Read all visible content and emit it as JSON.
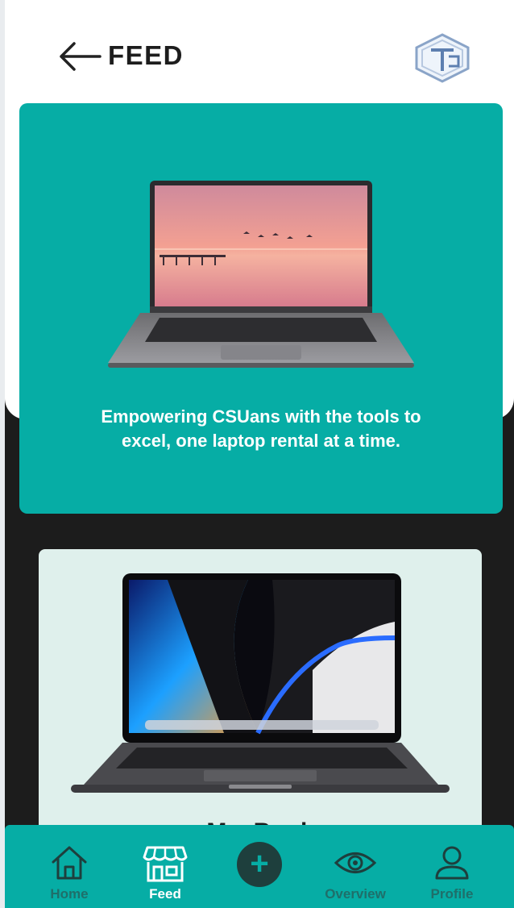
{
  "header": {
    "title": "FEED",
    "back_icon": "arrow-left-icon",
    "logo_icon": "ctu-logo-icon"
  },
  "hero": {
    "tagline": "Empowering CSUans with the tools to excel, one laptop rental at a time.",
    "image": "laptop-sunset-image"
  },
  "product": {
    "title": "MacBook",
    "image": "macbook-pro-image"
  },
  "nav": {
    "items": [
      {
        "label": "Home",
        "icon": "home-icon",
        "active": false
      },
      {
        "label": "Feed",
        "icon": "store-icon",
        "active": true
      },
      {
        "label": "",
        "icon": "plus-icon",
        "active": false
      },
      {
        "label": "Overview",
        "icon": "eye-icon",
        "active": false
      },
      {
        "label": "Profile",
        "icon": "user-icon",
        "active": false
      }
    ]
  },
  "colors": {
    "accent": "#06ada5",
    "dark": "#1c1c1c",
    "product_bg": "#dff0ec",
    "nav_inactive": "#1f6f6a",
    "fab": "#1e3f3d"
  }
}
